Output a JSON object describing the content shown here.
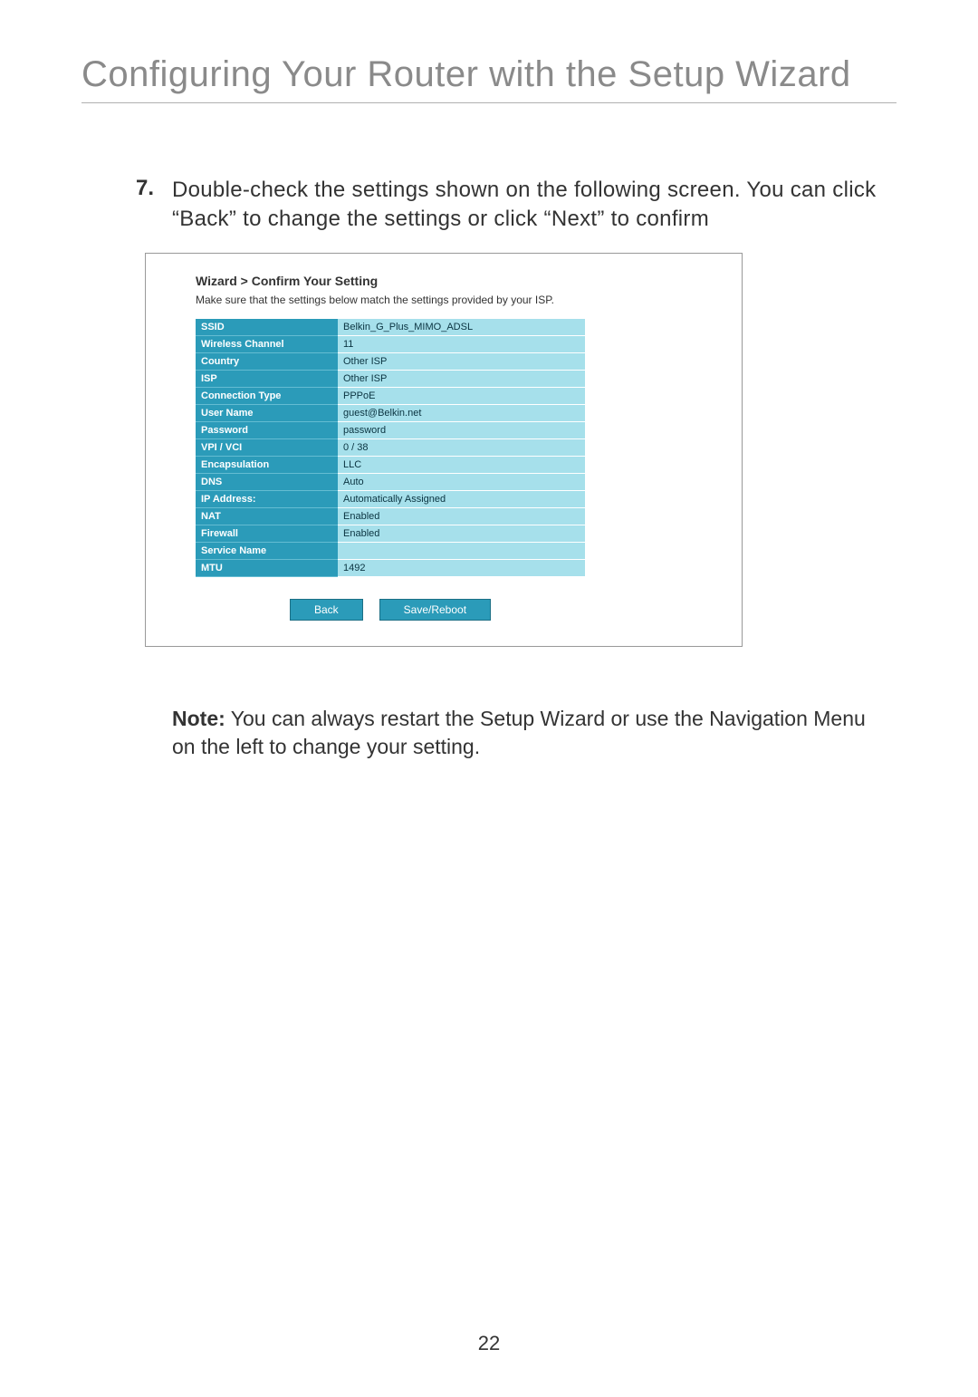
{
  "page_title": "Configuring Your Router with the Setup Wizard",
  "step": {
    "number": "7.",
    "text": "Double-check the settings shown on the following screen. You can click “Back” to change the settings or click “Next” to confirm"
  },
  "screenshot": {
    "breadcrumb": "Wizard > Confirm Your Setting",
    "subhead": "Make sure that the settings below match the settings provided by your ISP.",
    "rows": [
      {
        "label": "SSID",
        "value": "Belkin_G_Plus_MIMO_ADSL"
      },
      {
        "label": "Wireless Channel",
        "value": "11"
      },
      {
        "label": "Country",
        "value": "Other ISP"
      },
      {
        "label": "ISP",
        "value": "Other ISP"
      },
      {
        "label": "Connection Type",
        "value": "PPPoE"
      },
      {
        "label": "User Name",
        "value": "guest@Belkin.net"
      },
      {
        "label": "Password",
        "value": "password"
      },
      {
        "label": "VPI / VCI",
        "value": "0 / 38"
      },
      {
        "label": "Encapsulation",
        "value": "LLC"
      },
      {
        "label": "DNS",
        "value": "Auto"
      },
      {
        "label": "IP Address:",
        "value": "Automatically Assigned"
      },
      {
        "label": "NAT",
        "value": "Enabled"
      },
      {
        "label": "Firewall",
        "value": "Enabled"
      },
      {
        "label": "Service Name",
        "value": ""
      },
      {
        "label": "MTU",
        "value": "1492"
      }
    ],
    "buttons": {
      "back": "Back",
      "save": "Save/Reboot"
    }
  },
  "note": {
    "label": "Note:",
    "text": " You can always restart the Setup Wizard or use the Navigation Menu on the left to change your setting."
  },
  "page_number": "22"
}
